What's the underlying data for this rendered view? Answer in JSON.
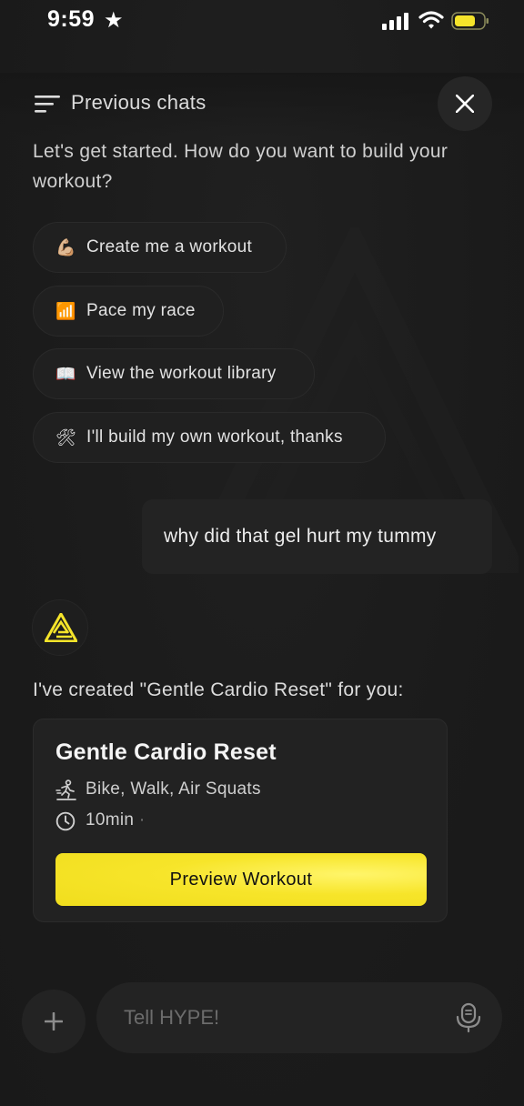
{
  "status_bar": {
    "time": "9:59"
  },
  "header": {
    "previous_chats_label": "Previous chats"
  },
  "intro": {
    "text": "Let's get started. How do you want to build your workout?"
  },
  "quick_replies": [
    {
      "icon": "💪🏼",
      "label": "Create me a workout"
    },
    {
      "icon": "📶",
      "label": "Pace my race"
    },
    {
      "icon": "📖",
      "label": "View the workout library"
    },
    {
      "icon": "🛠",
      "label": "I'll build my own workout, thanks"
    }
  ],
  "user_message": {
    "text": "why did that gel hurt my tummy"
  },
  "bot_message": {
    "text": "I've created \"Gentle Cardio Reset\" for you:"
  },
  "workout_card": {
    "title": "Gentle Cardio Reset",
    "activities": "Bike, Walk, Air Squats",
    "duration": "10min",
    "separator": "·",
    "preview_button": "Preview Workout"
  },
  "composer": {
    "placeholder": "Tell HYPE!"
  },
  "colors": {
    "accent": "#f5e42a",
    "background": "#1b1b1b",
    "surface": "#232323"
  }
}
